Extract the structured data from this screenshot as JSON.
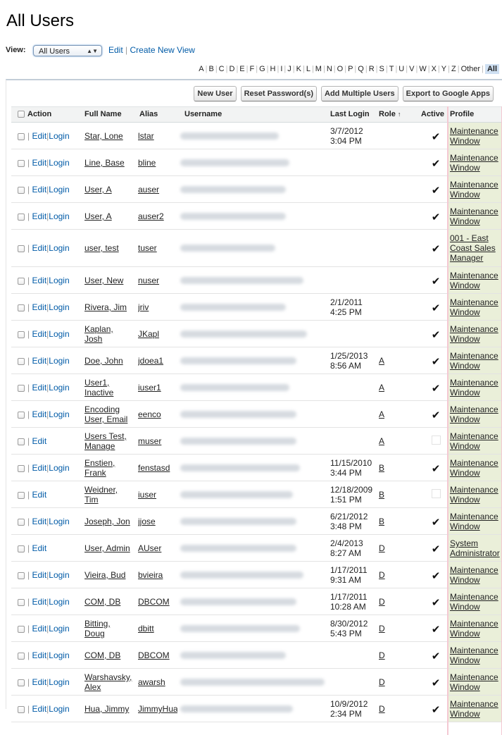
{
  "page_title": "All Users",
  "view": {
    "label": "View:",
    "selected": "All Users",
    "edit_link": "Edit",
    "create_link": "Create New View"
  },
  "alphabet": [
    "A",
    "B",
    "C",
    "D",
    "E",
    "F",
    "G",
    "H",
    "I",
    "J",
    "K",
    "L",
    "M",
    "N",
    "O",
    "P",
    "Q",
    "R",
    "S",
    "T",
    "U",
    "V",
    "W",
    "X",
    "Y",
    "Z",
    "Other",
    "All"
  ],
  "buttons": {
    "new_user": "New User",
    "reset_password": "Reset Password(s)",
    "add_multiple": "Add Multiple Users",
    "export": "Export to Google Apps"
  },
  "columns": {
    "action": "Action",
    "full_name": "Full Name",
    "alias": "Alias",
    "username": "Username",
    "last_login": "Last Login",
    "role": "Role",
    "role_sort": "↑",
    "active": "Active",
    "profile": "Profile"
  },
  "action_links": {
    "edit": "Edit",
    "login": "Login",
    "sep": "|"
  },
  "rows": [
    {
      "name": [
        "Star, Lone"
      ],
      "alias": "lstar",
      "login": [
        "3/7/2012",
        "3:04 PM"
      ],
      "role": "",
      "active": true,
      "profile": [
        "Maintenance",
        "Window"
      ],
      "has_login": true,
      "h": 37,
      "uw": 140
    },
    {
      "name": [
        "Line, Base"
      ],
      "alias": "bline",
      "login": [],
      "role": "",
      "active": true,
      "profile": [
        "Maintenance",
        "Window"
      ],
      "has_login": true,
      "h": 37,
      "uw": 155
    },
    {
      "name": [
        "User, A"
      ],
      "alias": "auser",
      "login": [],
      "role": "",
      "active": true,
      "profile": [
        "Maintenance",
        "Window"
      ],
      "has_login": true,
      "h": 37,
      "uw": 150
    },
    {
      "name": [
        "User, A"
      ],
      "alias": "auser2",
      "login": [],
      "role": "",
      "active": true,
      "profile": [
        "Maintenance",
        "Window"
      ],
      "has_login": true,
      "h": 37,
      "uw": 150
    },
    {
      "name": [
        "user, test"
      ],
      "alias": "tuser",
      "login": [],
      "role": "",
      "active": true,
      "profile": [
        "001 - East",
        "Coast Sales",
        "Manager"
      ],
      "has_login": true,
      "h": 52,
      "uw": 135
    },
    {
      "name": [
        "User, New"
      ],
      "alias": "nuser",
      "login": [],
      "role": "",
      "active": true,
      "profile": [
        "Maintenance",
        "Window"
      ],
      "has_login": true,
      "h": 37,
      "uw": 175
    },
    {
      "name": [
        "Rivera, Jim"
      ],
      "alias": "jriv",
      "login": [
        "2/1/2011",
        "4:25 PM"
      ],
      "role": "",
      "active": true,
      "profile": [
        "Maintenance",
        "Window"
      ],
      "has_login": true,
      "h": 37,
      "uw": 150
    },
    {
      "name": [
        "Kaplan,",
        "Josh"
      ],
      "alias": "JKapl",
      "login": [],
      "role": "",
      "active": true,
      "profile": [
        "Maintenance",
        "Window"
      ],
      "has_login": true,
      "h": 37,
      "uw": 180
    },
    {
      "name": [
        "Doe, John"
      ],
      "alias": "jdoea1",
      "login": [
        "1/25/2013",
        "8:56 AM"
      ],
      "role": "A",
      "active": true,
      "profile": [
        "Maintenance",
        "Window"
      ],
      "has_login": true,
      "h": 37,
      "uw": 165
    },
    {
      "name": [
        "User1,",
        "Inactive"
      ],
      "alias": "iuser1",
      "login": [],
      "role": "A",
      "active": true,
      "profile": [
        "Maintenance",
        "Window"
      ],
      "has_login": true,
      "h": 37,
      "uw": 155
    },
    {
      "name": [
        "Encoding",
        "User, Email"
      ],
      "alias": "eenco",
      "login": [],
      "role": "A",
      "active": true,
      "profile": [
        "Maintenance",
        "Window"
      ],
      "has_login": true,
      "h": 37,
      "uw": 165
    },
    {
      "name": [
        "Users Test,",
        "Manage"
      ],
      "alias": "muser",
      "login": [],
      "role": "A",
      "active": false,
      "profile": [
        "Maintenance",
        "Window"
      ],
      "has_login": false,
      "h": 37,
      "uw": 165
    },
    {
      "name": [
        "Enstien,",
        "Frank"
      ],
      "alias": "fenstasd",
      "login": [
        "11/15/2010",
        "3:44 PM"
      ],
      "role": "B",
      "active": true,
      "profile": [
        "Maintenance",
        "Window"
      ],
      "has_login": true,
      "h": 37,
      "uw": 170
    },
    {
      "name": [
        "Weidner,",
        "Tim"
      ],
      "alias": "iuser",
      "login": [
        "12/18/2009",
        "1:51 PM"
      ],
      "role": "B",
      "active": false,
      "profile": [
        "Maintenance",
        "Window"
      ],
      "has_login": false,
      "h": 37,
      "uw": 160
    },
    {
      "name": [
        "Joseph, Jon"
      ],
      "alias": "jjose",
      "login": [
        "6/21/2012",
        "3:48 PM"
      ],
      "role": "B",
      "active": true,
      "profile": [
        "Maintenance",
        "Window"
      ],
      "has_login": true,
      "h": 37,
      "uw": 165
    },
    {
      "name": [
        "User, Admin"
      ],
      "alias": "AUser",
      "login": [
        "2/4/2013",
        "8:27 AM"
      ],
      "role": "D",
      "active": true,
      "profile": [
        "System",
        "Administrator"
      ],
      "has_login": false,
      "h": 37,
      "uw": 165
    },
    {
      "name": [
        "Vieira, Bud"
      ],
      "alias": "bvieira",
      "login": [
        "1/17/2011",
        "9:31 AM"
      ],
      "role": "D",
      "active": true,
      "profile": [
        "Maintenance",
        "Window"
      ],
      "has_login": true,
      "h": 37,
      "uw": 175
    },
    {
      "name": [
        "COM, DB"
      ],
      "alias": "DBCOM",
      "login": [
        "1/17/2011",
        "10:28 AM"
      ],
      "role": "D",
      "active": true,
      "profile": [
        "Maintenance",
        "Window"
      ],
      "has_login": true,
      "h": 37,
      "uw": 165
    },
    {
      "name": [
        "Bitting,",
        "Doug"
      ],
      "alias": "dbitt",
      "login": [
        "8/30/2012",
        "5:43 PM"
      ],
      "role": "D",
      "active": true,
      "profile": [
        "Maintenance",
        "Window"
      ],
      "has_login": true,
      "h": 37,
      "uw": 170
    },
    {
      "name": [
        "COM, DB"
      ],
      "alias": "DBCOM",
      "login": [],
      "role": "D",
      "active": true,
      "profile": [
        "Maintenance",
        "Window"
      ],
      "has_login": true,
      "h": 37,
      "uw": 150
    },
    {
      "name": [
        "Warshavsky,",
        "Alex"
      ],
      "alias": "awarsh",
      "login": [],
      "role": "D",
      "active": true,
      "profile": [
        "Maintenance",
        "Window"
      ],
      "has_login": true,
      "h": 37,
      "uw": 205
    },
    {
      "name": [
        "Hua, Jimmy"
      ],
      "alias": "JimmyHua",
      "login": [
        "10/9/2012",
        "2:34 PM"
      ],
      "role": "D",
      "active": true,
      "profile": [
        "Maintenance",
        "Window"
      ],
      "has_login": true,
      "h": 37,
      "uw": 160
    }
  ]
}
